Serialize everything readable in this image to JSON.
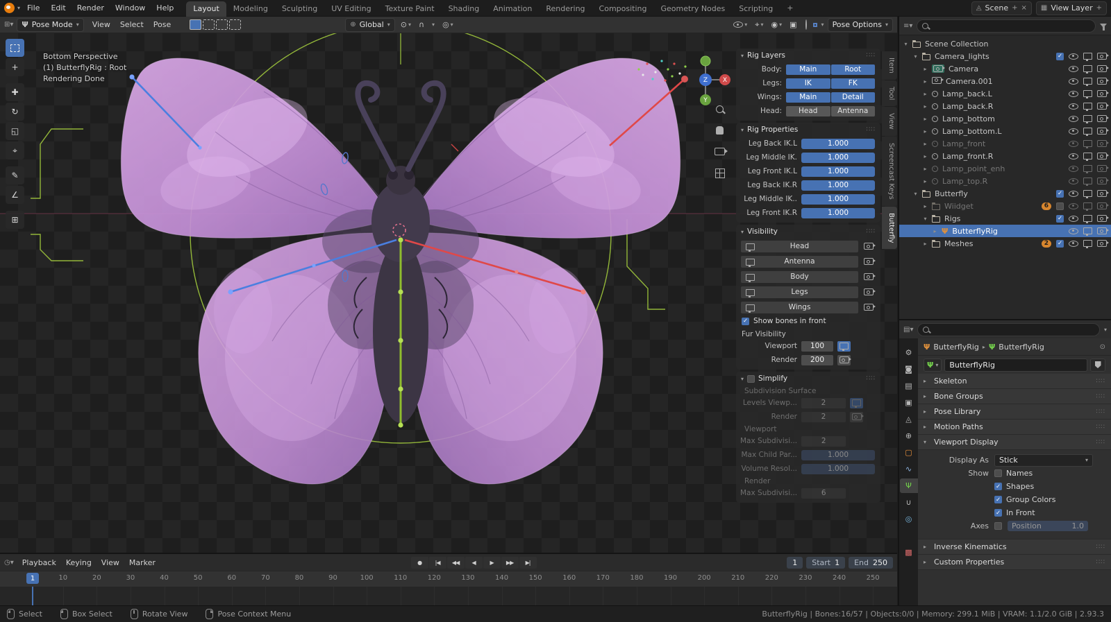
{
  "colors": {
    "accent": "#4772b3",
    "bone_left": "#4a7fe0",
    "bone_right": "#e04848",
    "bone_center": "#8fbc2e",
    "circle_green": "#a0c83c",
    "guide_red": "#a84a66",
    "selection": "#4772b3"
  },
  "topbar": {
    "menus": [
      "File",
      "Edit",
      "Render",
      "Window",
      "Help"
    ],
    "workspaces": [
      "Layout",
      "Modeling",
      "Sculpting",
      "UV Editing",
      "Texture Paint",
      "Shading",
      "Animation",
      "Rendering",
      "Compositing",
      "Geometry Nodes",
      "Scripting"
    ],
    "active_workspace": "Layout",
    "add_workspace": "+",
    "scene": "Scene",
    "view_layer": "View Layer"
  },
  "viewport": {
    "mode": "Pose Mode",
    "menus": [
      "View",
      "Select",
      "Pose"
    ],
    "select_modes": [
      "set",
      "extend",
      "subtract",
      "invert"
    ],
    "orientation": "Global",
    "pose_options": "Pose Options",
    "overlay_line1": "Bottom Perspective",
    "overlay_line2": "(1) ButterflyRig : Root",
    "overlay_line3": "Rendering Done",
    "gizmo": {
      "x": "X",
      "y": "Y",
      "z": "Z"
    },
    "shading_modes": [
      "wireframe",
      "solid",
      "material",
      "rendered"
    ],
    "active_shading": "rendered"
  },
  "tools": [
    "box-select",
    "cursor",
    "move",
    "rotate",
    "scale",
    "transform",
    "annotate",
    "measure",
    "add"
  ],
  "side_tabs": [
    {
      "label": "Item",
      "active": false
    },
    {
      "label": "Tool",
      "active": false
    },
    {
      "label": "View",
      "active": false
    },
    {
      "label": "Screencast Keys",
      "active": false
    },
    {
      "label": "Butterfly",
      "active": true
    }
  ],
  "n_panel": {
    "rig_layers": {
      "title": "Rig Layers",
      "rows": [
        {
          "label": "Body:",
          "buttons": [
            {
              "label": "Main",
              "on": true
            },
            {
              "label": "Root",
              "on": true
            }
          ]
        },
        {
          "label": "Legs:",
          "buttons": [
            {
              "label": "IK",
              "on": true
            },
            {
              "label": "FK",
              "on": true
            }
          ]
        },
        {
          "label": "Wings:",
          "buttons": [
            {
              "label": "Main",
              "on": true
            },
            {
              "label": "Detail",
              "on": true
            }
          ]
        },
        {
          "label": "Head:",
          "buttons": [
            {
              "label": "Head",
              "on": false
            },
            {
              "label": "Antenna",
              "on": false
            }
          ]
        }
      ]
    },
    "rig_properties": {
      "title": "Rig Properties",
      "sliders": [
        {
          "label": "Leg Back IK.L",
          "value": "1.000"
        },
        {
          "label": "Leg Middle IK.",
          "value": "1.000"
        },
        {
          "label": "Leg Front IK.L",
          "value": "1.000"
        },
        {
          "label": "Leg Back IK.R",
          "value": "1.000"
        },
        {
          "label": "Leg Middle IK..",
          "value": "1.000"
        },
        {
          "label": "Leg Front IK.R",
          "value": "1.000"
        }
      ]
    },
    "visibility": {
      "title": "Visibility",
      "toggles": [
        "Head",
        "Antenna",
        "Body",
        "Legs",
        "Wings"
      ],
      "show_bones_label": "Show bones in front",
      "show_bones_checked": true,
      "fur_title": "Fur Visibility",
      "fur_rows": [
        {
          "label": "Viewport",
          "value": "100",
          "icon": "screen"
        },
        {
          "label": "Render",
          "value": "200",
          "icon": "camera"
        }
      ]
    },
    "simplify": {
      "title": "Simplify",
      "checked": false,
      "groups": [
        {
          "heading": "Subdivision Surface",
          "rows": [
            {
              "label": "Levels Viewp...",
              "value": "2",
              "icon": "screen",
              "style": "field"
            },
            {
              "label": "Render",
              "value": "2",
              "icon": "camera",
              "style": "field"
            }
          ]
        },
        {
          "heading": "Viewport",
          "rows": [
            {
              "label": "Max Subdivisi...",
              "value": "2",
              "style": "field"
            },
            {
              "label": "Max Child Par...",
              "value": "1.000",
              "style": "slider"
            },
            {
              "label": "Volume Resol...",
              "value": "1.000",
              "style": "slider"
            }
          ]
        },
        {
          "heading": "Render",
          "rows": [
            {
              "label": "Max Subdivisi...",
              "value": "6",
              "style": "field"
            }
          ]
        }
      ]
    }
  },
  "outliner": {
    "rows": [
      {
        "label": "Scene Collection",
        "level": 0,
        "arrow": "open",
        "icon": "collection",
        "trail": []
      },
      {
        "label": "Camera_lights",
        "level": 1,
        "arrow": "open",
        "icon": "collection",
        "check": true,
        "trail": [
          "eye",
          "screen",
          "camera"
        ]
      },
      {
        "label": "Camera",
        "level": 2,
        "arrow": "closed",
        "icon": "camera",
        "camera_active": true,
        "trail": [
          "eye",
          "screen",
          "camera"
        ]
      },
      {
        "label": "Camera.001",
        "level": 2,
        "arrow": "closed",
        "icon": "camera",
        "trail": [
          "eye",
          "screen",
          "camera"
        ]
      },
      {
        "label": "Lamp_back.L",
        "level": 2,
        "arrow": "closed",
        "icon": "light",
        "trail": [
          "eye",
          "screen",
          "camera"
        ]
      },
      {
        "label": "Lamp_back.R",
        "level": 2,
        "arrow": "closed",
        "icon": "light",
        "trail": [
          "eye",
          "screen",
          "camera"
        ]
      },
      {
        "label": "Lamp_bottom",
        "level": 2,
        "arrow": "closed",
        "icon": "light",
        "trail": [
          "eye",
          "screen",
          "camera"
        ]
      },
      {
        "label": "Lamp_bottom.L",
        "level": 2,
        "arrow": "closed",
        "icon": "light",
        "trail": [
          "eye",
          "screen",
          "camera"
        ]
      },
      {
        "label": "Lamp_front",
        "level": 2,
        "arrow": "closed",
        "icon": "light",
        "dim": true,
        "trail": [
          "eye",
          "screen",
          "camera"
        ]
      },
      {
        "label": "Lamp_front.R",
        "level": 2,
        "arrow": "closed",
        "icon": "light",
        "trail": [
          "eye",
          "screen",
          "camera"
        ]
      },
      {
        "label": "Lamp_point_enh",
        "level": 2,
        "arrow": "closed",
        "icon": "light",
        "dim": true,
        "trail": [
          "eye",
          "screen",
          "camera"
        ]
      },
      {
        "label": "Lamp_top.R",
        "level": 2,
        "arrow": "closed",
        "icon": "light",
        "dim": true,
        "trail": [
          "eye",
          "screen",
          "camera"
        ]
      },
      {
        "label": "Butterfly",
        "level": 1,
        "arrow": "open",
        "icon": "collection",
        "check": true,
        "trail": [
          "eye",
          "screen",
          "camera"
        ]
      },
      {
        "label": "Wiidget",
        "level": 2,
        "arrow": "closed",
        "icon": "collection",
        "dim": true,
        "badge": "6",
        "check": false,
        "trail": [
          "eye",
          "screen",
          "camera"
        ]
      },
      {
        "label": "Rigs",
        "level": 2,
        "arrow": "open",
        "icon": "collection",
        "check": true,
        "trail": [
          "eye",
          "screen",
          "camera"
        ]
      },
      {
        "label": "ButterflyRig",
        "level": 3,
        "arrow": "closed",
        "icon": "armature",
        "selected": true,
        "trail": [
          "eye",
          "screen",
          "camera"
        ]
      },
      {
        "label": "Meshes",
        "level": 2,
        "arrow": "closed",
        "icon": "collection",
        "badge": "2",
        "check": true,
        "trail": [
          "eye",
          "screen",
          "camera"
        ]
      }
    ]
  },
  "properties": {
    "breadcrumb1": "ButterflyRig",
    "breadcrumb2": "ButterflyRig",
    "name_value": "ButterflyRig",
    "tabs": [
      {
        "id": "tool",
        "glyph": "⚙",
        "color": "#b8b8b8",
        "active": false
      },
      {
        "id": "render",
        "glyph": "◙",
        "color": "#b8b8b8",
        "active": false
      },
      {
        "id": "output",
        "glyph": "▤",
        "color": "#b8b8b8",
        "active": false
      },
      {
        "id": "view-layer",
        "glyph": "▣",
        "color": "#b8b8b8",
        "active": false
      },
      {
        "id": "scene",
        "glyph": "◬",
        "color": "#b8b8b8",
        "active": false
      },
      {
        "id": "world",
        "glyph": "⊕",
        "color": "#b8b8b8",
        "active": false
      },
      {
        "id": "object",
        "glyph": "▢",
        "color": "#e8913c",
        "active": false
      },
      {
        "id": "constraints",
        "glyph": "∿",
        "color": "#8fb4e0",
        "active": false
      },
      {
        "id": "data",
        "glyph": "Ψ",
        "color": "#74d14c",
        "active": true
      },
      {
        "id": "bone",
        "glyph": "∪",
        "color": "#b8b8b8",
        "active": false
      },
      {
        "id": "physics",
        "glyph": "◎",
        "color": "#7ab8e0",
        "active": false
      },
      {
        "id": "texture",
        "glyph": "▩",
        "color": "#d96a6a",
        "active": false,
        "gap": true
      }
    ],
    "panels": [
      {
        "label": "Skeleton",
        "expanded": false
      },
      {
        "label": "Bone Groups",
        "expanded": false
      },
      {
        "label": "Pose Library",
        "expanded": false
      },
      {
        "label": "Motion Paths",
        "expanded": false
      },
      {
        "label": "Viewport Display",
        "expanded": true
      },
      {
        "label": "Inverse Kinematics",
        "expanded": false
      },
      {
        "label": "Custom Properties",
        "expanded": false
      }
    ],
    "viewport_display": {
      "display_as_label": "Display As",
      "display_as_value": "Stick",
      "show_label": "Show",
      "checkboxes": [
        {
          "label": "Names",
          "checked": false
        },
        {
          "label": "Shapes",
          "checked": true
        },
        {
          "label": "Group Colors",
          "checked": true
        },
        {
          "label": "In Front",
          "checked": true
        }
      ],
      "axes_label": "Axes",
      "axes_checked": false,
      "position_label": "Position",
      "position_value": "1.0"
    }
  },
  "timeline": {
    "menus": [
      "Playback",
      "Keying",
      "View",
      "Marker"
    ],
    "transport": [
      {
        "name": "auto-key",
        "glyph": "●"
      },
      {
        "name": "jump-to-start",
        "glyph": "|◀"
      },
      {
        "name": "prev-keyframe",
        "glyph": "◀◀"
      },
      {
        "name": "play-reverse",
        "glyph": "◀"
      },
      {
        "name": "play",
        "glyph": "▶"
      },
      {
        "name": "next-keyframe",
        "glyph": "▶▶"
      },
      {
        "name": "jump-to-end",
        "glyph": "▶|"
      }
    ],
    "current_frame": "1",
    "frame_field": "1",
    "start_label": "Start",
    "start_value": "1",
    "end_label": "End",
    "end_value": "250",
    "ticks": [
      10,
      20,
      30,
      40,
      50,
      60,
      70,
      80,
      90,
      100,
      110,
      120,
      130,
      140,
      150,
      160,
      170,
      180,
      190,
      200,
      210,
      220,
      230,
      240,
      250
    ]
  },
  "statusbar": {
    "hints": [
      {
        "icon": "mb-left",
        "label": "Select"
      },
      {
        "icon": "mb-left",
        "label": "Box Select"
      },
      {
        "icon": "mb-mid",
        "label": "Rotate View"
      },
      {
        "icon": "mb-right",
        "label": "Pose Context Menu"
      }
    ],
    "info": "ButterflyRig | Bones:16/57 | Objects:0/0 | Memory: 299.1 MiB | VRAM: 1.1/2.0 GiB | 2.93.3"
  }
}
